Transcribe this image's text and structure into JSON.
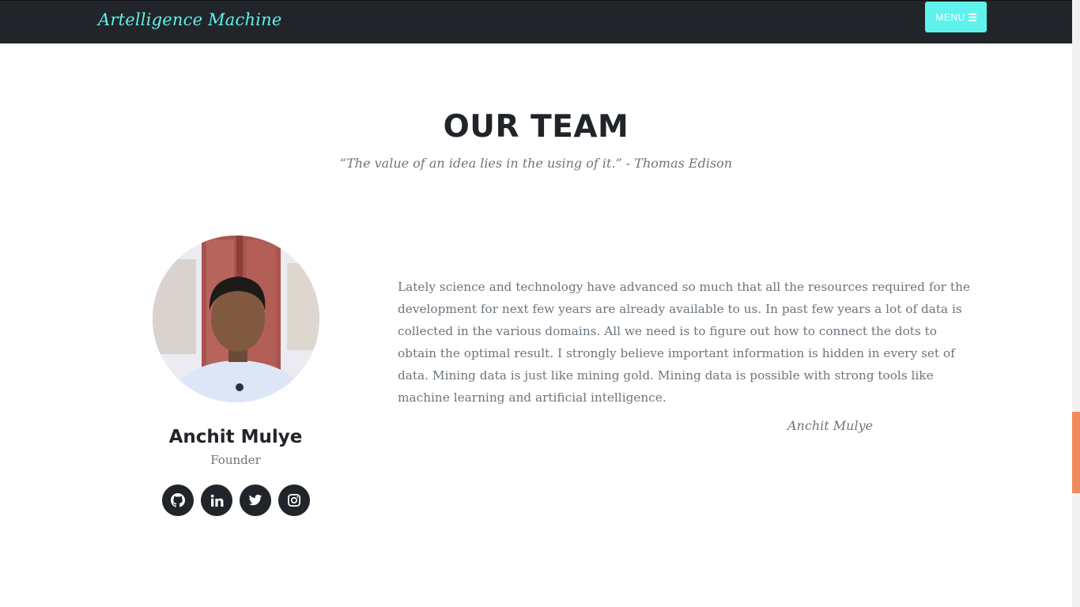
{
  "navbar": {
    "brand": "Artelligence Machine",
    "menu_label": "MENU",
    "menu_icon": "bars-icon"
  },
  "team": {
    "title": "OUR TEAM",
    "quote": "“The value of an idea lies in the using of it.” - Thomas Edison",
    "members": [
      {
        "name": "Anchit Mulye",
        "role": "Founder",
        "bio": "Lately science and technology have advanced so much that all the resources required for the development for next few years are already available to us. In past few years a lot of data is collected in the various domains. All we need is to figure out how to connect the dots to obtain the optimal result. I strongly believe important information is hidden in every set of data. Mining data is just like mining gold. Mining data is possible with strong tools like machine learning and artificial intelligence.",
        "signature": "Anchit Mulye",
        "social": [
          "github-icon",
          "linkedin-icon",
          "twitter-icon",
          "instagram-icon"
        ]
      }
    ]
  },
  "colors": {
    "navbar_bg": "#212529",
    "accent": "#5ff2ec",
    "heading": "#212529",
    "muted_text": "#6c757d",
    "scroll_thumb": "#ee8a5b"
  }
}
